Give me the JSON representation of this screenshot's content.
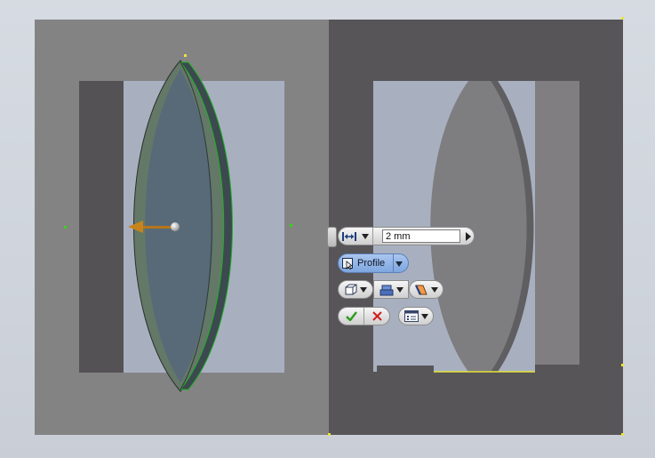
{
  "viewport": {
    "background": "#d3d8df",
    "model_face_light": "#848384",
    "model_face_dark": "#575558",
    "lens_preview_color": "#5c6c78",
    "lens_ghost_color": "#7e7d80",
    "sketch_point_color": "#35d41c",
    "arrow_color": "#c8841b"
  },
  "mini_toolbar": {
    "distance_icon": "distance-dimension-icon",
    "distance_value": "2 mm",
    "apply_arrow_icon": "play-right-icon",
    "profile_label": "Profile",
    "profile_icon": "profile-select-icon",
    "output_icon": "solid-output-icon",
    "direction_icon": "extrude-direction-icon",
    "boolean_icon": "boolean-operation-icon",
    "ok_icon": "checkmark-icon",
    "cancel_icon": "cancel-x-icon",
    "options_icon": "options-menu-icon",
    "ok_color": "#2e9a20",
    "cancel_color": "#cf1d1d"
  }
}
